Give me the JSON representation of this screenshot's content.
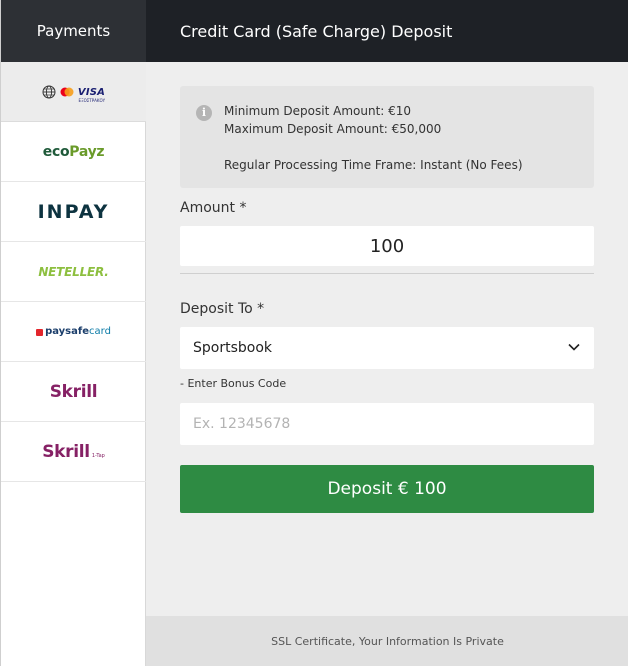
{
  "left_header": {
    "title": "Payments"
  },
  "right_header": {
    "title": "Credit Card (Safe Charge) Deposit"
  },
  "sidebar": {
    "items": [
      {
        "name": "visa-mastercard",
        "label": "VISA",
        "sub": "ΕΞΟΣΤΡΑΚΟΥ",
        "active": true
      },
      {
        "name": "ecopayz",
        "label_a": "eco",
        "label_b": "Payz"
      },
      {
        "name": "inpay",
        "label": "INPAY"
      },
      {
        "name": "neteller",
        "label": "NETELLER."
      },
      {
        "name": "paysafecard",
        "label_a": "paysafe",
        "label_b": "card"
      },
      {
        "name": "skrill",
        "label": "Skrill"
      },
      {
        "name": "skrill-1tap",
        "label": "Skrill",
        "sub": "1-Tap"
      }
    ]
  },
  "info": {
    "min_deposit": "Minimum Deposit Amount: €10",
    "max_deposit": "Maximum Deposit Amount: €50,000",
    "processing": "Regular Processing Time Frame: Instant (No Fees)"
  },
  "form": {
    "amount_label": "Amount *",
    "amount_value": "100",
    "deposit_to_label": "Deposit To *",
    "deposit_to_value": "Sportsbook",
    "bonus_label": "- Enter Bonus Code",
    "bonus_placeholder": "Ex. 12345678",
    "deposit_button": "Deposit € 100"
  },
  "footer": {
    "text": "SSL Certificate, Your Information Is Private"
  },
  "colors": {
    "header_left": "#2d3035",
    "header_right": "#1e2126",
    "button_green": "#2e8b43",
    "panel_bg": "#eeeeee"
  }
}
